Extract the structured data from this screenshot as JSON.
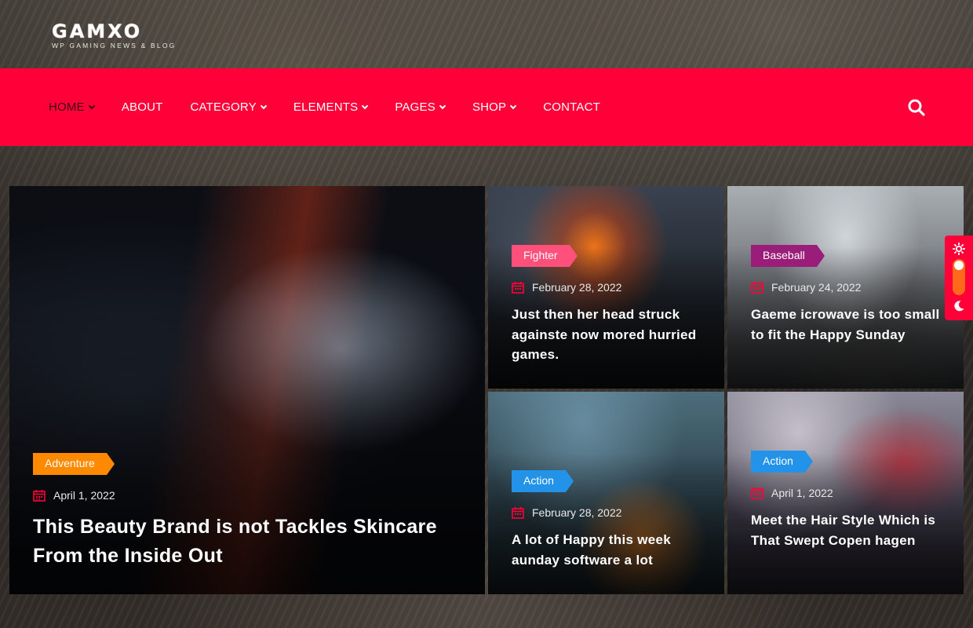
{
  "brand": {
    "name": "GAMXO",
    "tagline": "WP GAMING NEWS & BLOG"
  },
  "nav": {
    "items": [
      {
        "label": "HOME",
        "dropdown": true,
        "active": true
      },
      {
        "label": "ABOUT",
        "dropdown": false
      },
      {
        "label": "CATEGORY",
        "dropdown": true
      },
      {
        "label": "ELEMENTS",
        "dropdown": true
      },
      {
        "label": "PAGES",
        "dropdown": true
      },
      {
        "label": "SHOP",
        "dropdown": true
      },
      {
        "label": "CONTACT",
        "dropdown": false
      }
    ],
    "search_icon": "search-icon"
  },
  "posts": [
    {
      "category": "Adventure",
      "category_color": "#ff8a00",
      "date": "April 1, 2022",
      "title": "This Beauty Brand is not Tackles Skincare From the Inside Out"
    },
    {
      "category": "Fighter",
      "category_color": "#ff4f7b",
      "date": "February 28, 2022",
      "title": "Just then her head struck againste now mored hurried games."
    },
    {
      "category": "Baseball",
      "category_color": "#9b1d7a",
      "date": "February 24, 2022",
      "title": "Gaeme icrowave is too small to fit the Happy Sunday"
    },
    {
      "category": "Action",
      "category_color": "#2293e8",
      "date": "February 28, 2022",
      "title": "A lot of Happy this week aunday software a lot"
    },
    {
      "category": "Action",
      "category_color": "#2293e8",
      "date": "April 1, 2022",
      "title": "Meet the Hair Style Which is That Swept Copen hagen"
    }
  ],
  "colors": {
    "accent": "#ff0038",
    "calendar_icon": "#ff0038"
  },
  "theme_switcher": {
    "light_icon": "sun-icon",
    "dark_icon": "moon-icon"
  }
}
